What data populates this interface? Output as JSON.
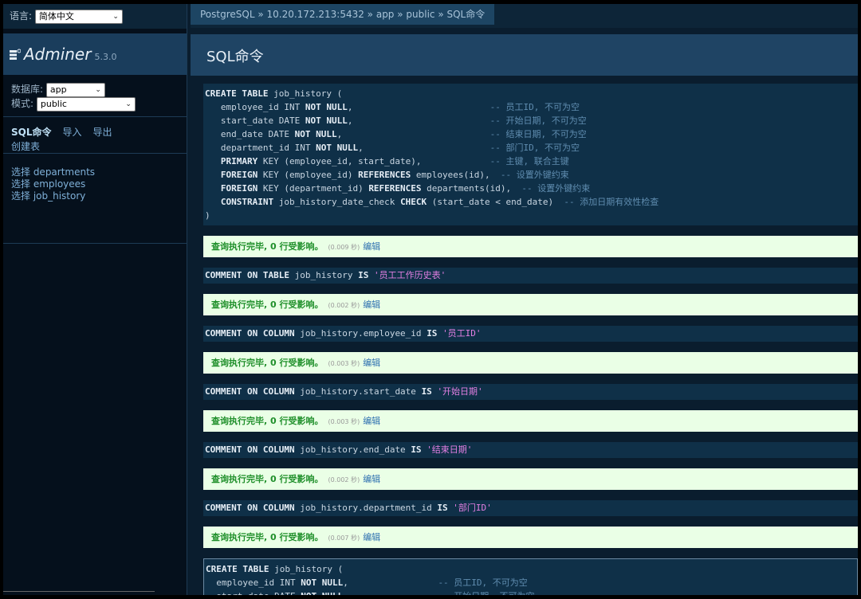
{
  "sidebar": {
    "lang_label": "语言:",
    "lang_value": "简体中文",
    "brand_name": "Adminer",
    "brand_version": "5.3.0",
    "db_label": "数据库:",
    "db_value": "app",
    "schema_label": "模式:",
    "schema_value": "public",
    "links": [
      "SQL命令",
      "导入",
      "导出"
    ],
    "create_table": "创建表",
    "tables": [
      "选择 departments",
      "选择 employees",
      "选择 job_history"
    ]
  },
  "breadcrumb": "PostgreSQL » 10.20.172.213:5432 » app » public » SQL命令",
  "page_title": "SQL命令",
  "queries": [
    {
      "lines": [
        {
          "code": "CREATE TABLE job_history (",
          "comment": ""
        },
        {
          "code": "   employee_id INT NOT NULL,",
          "comment": "-- 员工ID, 不可为空"
        },
        {
          "code": "   start_date DATE NOT NULL,",
          "comment": "-- 开始日期, 不可为空"
        },
        {
          "code": "   end_date DATE NOT NULL,",
          "comment": "-- 结束日期, 不可为空"
        },
        {
          "code": "   department_id INT NOT NULL,",
          "comment": "-- 部门ID, 不可为空"
        },
        {
          "code": "   PRIMARY KEY (employee_id, start_date),",
          "comment": "-- 主键, 联合主键"
        },
        {
          "code": "   FOREIGN KEY (employee_id) REFERENCES employees(id),",
          "comment": "-- 设置外键约束"
        },
        {
          "code": "   FOREIGN KEY (department_id) REFERENCES departments(id),",
          "comment": "-- 设置外键约束"
        },
        {
          "code": "   CONSTRAINT job_history_date_check CHECK (start_date < end_date)",
          "comment": "-- 添加日期有效性检查"
        },
        {
          "code": ")",
          "comment": ""
        }
      ],
      "result": "查询执行完毕, 0 行受影响。",
      "time": "(0.009 秒)",
      "edit": "编辑"
    },
    {
      "code": "COMMENT ON TABLE job_history IS ",
      "string": "'员工工作历史表'",
      "result": "查询执行完毕, 0 行受影响。",
      "time": "(0.002 秒)",
      "edit": "编辑"
    },
    {
      "code": "COMMENT ON COLUMN job_history.employee_id IS ",
      "string": "'员工ID'",
      "result": "查询执行完毕, 0 行受影响。",
      "time": "(0.003 秒)",
      "edit": "编辑"
    },
    {
      "code": "COMMENT ON COLUMN job_history.start_date IS ",
      "string": "'开始日期'",
      "result": "查询执行完毕, 0 行受影响。",
      "time": "(0.003 秒)",
      "edit": "编辑"
    },
    {
      "code": "COMMENT ON COLUMN job_history.end_date IS ",
      "string": "'结束日期'",
      "result": "查询执行完毕, 0 行受影响。",
      "time": "(0.002 秒)",
      "edit": "编辑"
    },
    {
      "code": "COMMENT ON COLUMN job_history.department_id IS ",
      "string": "'部门ID'",
      "result": "查询执行完毕, 0 行受影响。",
      "time": "(0.007 秒)",
      "edit": "编辑"
    }
  ],
  "editor": {
    "lines": [
      {
        "code": "CREATE TABLE job_history (",
        "comment": ""
      },
      {
        "code": "  employee_id INT NOT NULL,",
        "comment": "-- 员工ID, 不可为空"
      },
      {
        "code": "  start_date DATE NOT NULL,",
        "comment": "-- 开始日期, 不可为空"
      }
    ]
  }
}
